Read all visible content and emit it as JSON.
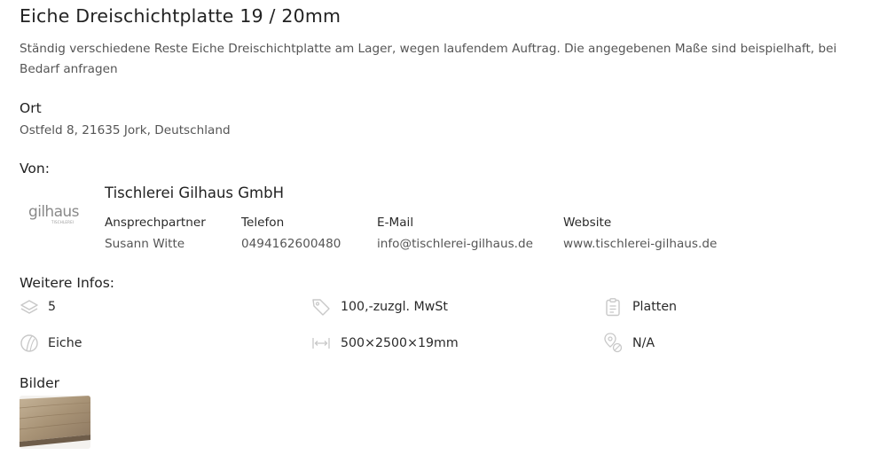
{
  "listing": {
    "title": "Eiche Dreischichtplatte 19 / 20mm",
    "description": "Ständig verschiedene Reste Eiche Dreischichtplatte am Lager, wegen laufendem Auftrag. Die angegebenen Maße sind beispielhaft, bei Bedarf anfragen"
  },
  "location": {
    "heading": "Ort",
    "address": "Ostfeld 8, 21635 Jork, Deutschland"
  },
  "seller": {
    "heading": "Von:",
    "logo_text": "gilhaus",
    "logo_subtext": "TISCHLEREI",
    "company": "Tischlerei Gilhaus GmbH",
    "contact_label": "Ansprechpartner",
    "contact_value": "Susann Witte",
    "phone_label": "Telefon",
    "phone_value": "0494162600480",
    "email_label": "E-Mail",
    "email_value": "info@tischlerei-gilhaus.de",
    "website_label": "Website",
    "website_value": "www.tischlerei-gilhaus.de"
  },
  "more_info": {
    "heading": "Weitere Infos:",
    "items": [
      {
        "icon": "layers-icon",
        "value": "5"
      },
      {
        "icon": "price-tag-icon",
        "value": "100,-zuzgl. MwSt"
      },
      {
        "icon": "clipboard-icon",
        "value": "Platten"
      },
      {
        "icon": "wood-grain-icon",
        "value": "Eiche"
      },
      {
        "icon": "dimensions-icon",
        "value": "500×2500×19mm"
      },
      {
        "icon": "location-pin-icon",
        "value": "N/A"
      }
    ]
  },
  "images": {
    "heading": "Bilder"
  },
  "colors": {
    "icon_gray": "#c8c8c8",
    "text_dark": "#2a2a2a",
    "text_muted": "#555555",
    "wood_light": "#b9a58a",
    "wood_dark": "#7d6a55"
  }
}
